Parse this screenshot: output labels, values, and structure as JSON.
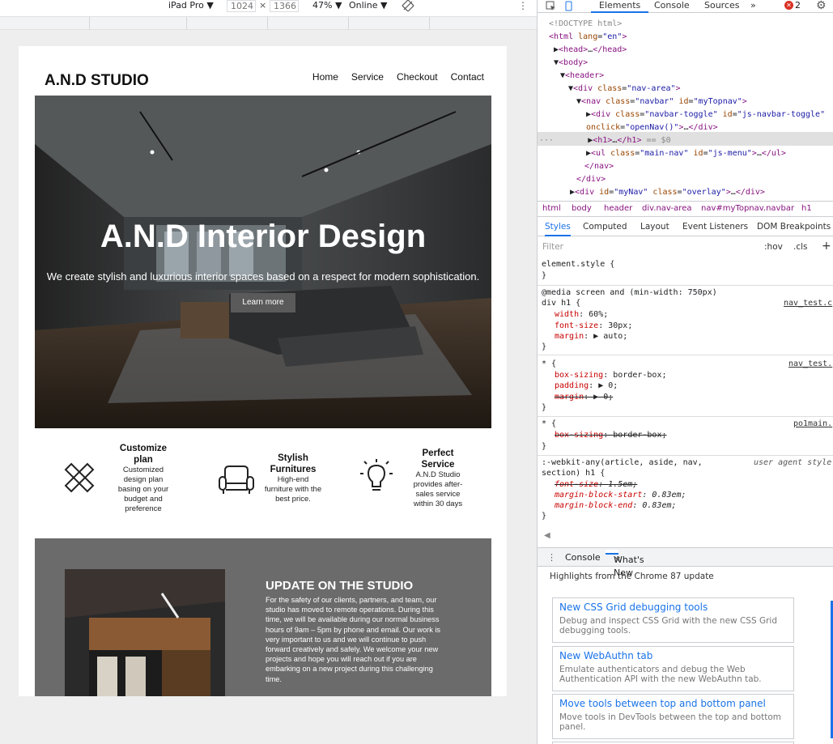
{
  "device_toolbar": {
    "device": "iPad Pro",
    "width": "1024",
    "height": "1366",
    "zoom": "47%",
    "throttle": "Online",
    "dropdown_arrow": "▼",
    "times": "×",
    "kebab": "⋮"
  },
  "site": {
    "logo": "A.N.D STUDIO",
    "nav": [
      "Home",
      "Service",
      "Checkout",
      "Contact"
    ],
    "hero_title": "A.N.D Interior Design",
    "hero_subtitle": "We create stylish and luxurious interior spaces based on a respect for modern sophistication.",
    "hero_button": "Learn more",
    "features": [
      {
        "icon": "ruler-pencil-icon",
        "title": "Customize plan",
        "desc": "Customized design plan basing on your budget and preference"
      },
      {
        "icon": "armchair-icon",
        "title": "Stylish Furnitures",
        "desc": "High-end furniture with the best price."
      },
      {
        "icon": "lightbulb-icon",
        "title": "Perfect Service",
        "desc": "A.N.D Studio provides after-sales service within 30 days"
      }
    ],
    "update_title": "UPDATE ON THE STUDIO",
    "update_body": "For the safety of our clients, partners, and team, our studio has moved to remote operations. During this time, we will be available during our normal business hours of 9am – 5pm by phone and email. Our work is very important to us and we will continue to push forward creatively and safely. We welcome your new projects and hope you will reach out if you are embarking on a new project during this challenging time."
  },
  "devtools": {
    "tabs": [
      "Elements",
      "Console",
      "Sources",
      "»"
    ],
    "active_tab": "Elements",
    "error_count": "2",
    "crumbs": [
      "html",
      "body",
      "header",
      "div.nav-area",
      "nav#myTopnav.navbar",
      "h1"
    ],
    "subtabs": [
      "Styles",
      "Computed",
      "Layout",
      "Event Listeners",
      "DOM Breakpoints"
    ],
    "filter_placeholder": "Filter",
    "hov": ":hov",
    "cls": ".cls",
    "plus": "+",
    "drawer_tabs": [
      "Console",
      "What's New"
    ],
    "whatsnew_heading": "Highlights from the Chrome 87 update",
    "cards": [
      {
        "title": "New CSS Grid debugging tools",
        "desc": "Debug and inspect CSS Grid with the new CSS Grid debugging tools."
      },
      {
        "title": "New WebAuthn tab",
        "desc": "Emulate authenticators and debug the Web Authentication API with the new WebAuthn tab."
      },
      {
        "title": "Move tools between top and bottom panel",
        "desc": "Move tools in DevTools between the top and bottom panel."
      }
    ]
  }
}
